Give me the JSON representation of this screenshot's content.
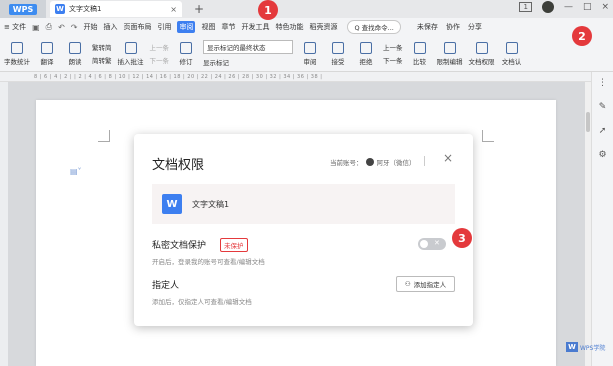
{
  "titlebar": {
    "app_tab": "WPS",
    "doc_tab": "文字文稿1",
    "doc_icon": "W",
    "close": "×",
    "add_tab": "+",
    "win_num": "1",
    "minimize": "—",
    "restore": "□",
    "close_window": "×"
  },
  "menu": {
    "file": "≡ 文件",
    "items": [
      "开始",
      "插入",
      "页面布局",
      "引用",
      "审阅",
      "视图",
      "章节",
      "开发工具",
      "特色功能",
      "稻壳资源"
    ],
    "active": "审阅",
    "search": "Q 查找命令...",
    "unsaved": "未保存",
    "collab": "协作",
    "share": "分享"
  },
  "toolbar": {
    "word_count": "字数统计",
    "translate": "翻译",
    "read_aloud": "朗读",
    "to_traditional": "繁转简",
    "to_simplified": "简转繁",
    "insert_comment": "插入批注",
    "delete": "删除",
    "prev_comment": "上一条",
    "next_comment": "下一条",
    "revise": "修订",
    "final_state": "显示标记的最终状态",
    "show_marks": "显示标记",
    "review": "审阅",
    "accept": "接受",
    "reject": "拒绝",
    "prev": "上一条",
    "next": "下一条",
    "compare": "比较",
    "restrict": "限制编辑",
    "doc_permission": "文档权限",
    "doc_verify": "文档认"
  },
  "ruler": "8 | 6 | 4 | 2 | | 2 | 4 | 6 | 8 | 10 | 12 | 14 | 16 | 18 | 20 | 22 | 24 | 26 | 28 | 30 | 32 | 34 | 36 | 38 |",
  "dialog": {
    "title": "文档权限",
    "account_label": "当前账号：",
    "account_name": "阿牙（微信）",
    "close": "×",
    "file_icon": "W",
    "file_name": "文字文稿1",
    "private_title": "私密文档保护",
    "private_badge": "未保护",
    "private_desc": "开启后，登录我的账号可查看/编辑文档",
    "toggle_state": "off",
    "designated_title": "指定人",
    "designated_desc": "添加后，仅指定人可查看/编辑文档",
    "add_button": "添加指定人"
  },
  "callouts": {
    "one": "1",
    "two": "2",
    "three": "3"
  },
  "watermark": {
    "logo": "W",
    "text": "WPS学院"
  },
  "colors": {
    "accent": "#3d7ff0",
    "callout": "#e4393c",
    "badge": "#e4393c"
  }
}
